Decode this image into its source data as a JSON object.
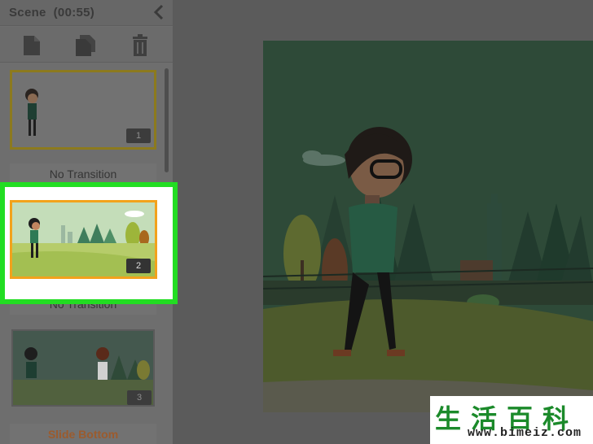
{
  "panel": {
    "title": "Scene",
    "duration": "(00:55)"
  },
  "scenes": [
    {
      "number": "1",
      "transition": "No Transition"
    },
    {
      "number": "2",
      "transition": "No Transition"
    },
    {
      "number": "3",
      "transition": "Slide Bottom"
    }
  ],
  "toolbar": {
    "icons": [
      "new-scene-icon",
      "duplicate-scene-icon",
      "trash-icon"
    ]
  },
  "colors": {
    "highlight": "#22dd22",
    "selected_border": "#f2a21c",
    "watermark_green": "#1b8a2a"
  },
  "watermark": {
    "chars": "生活百科",
    "url": "www.bimeiz.com"
  }
}
